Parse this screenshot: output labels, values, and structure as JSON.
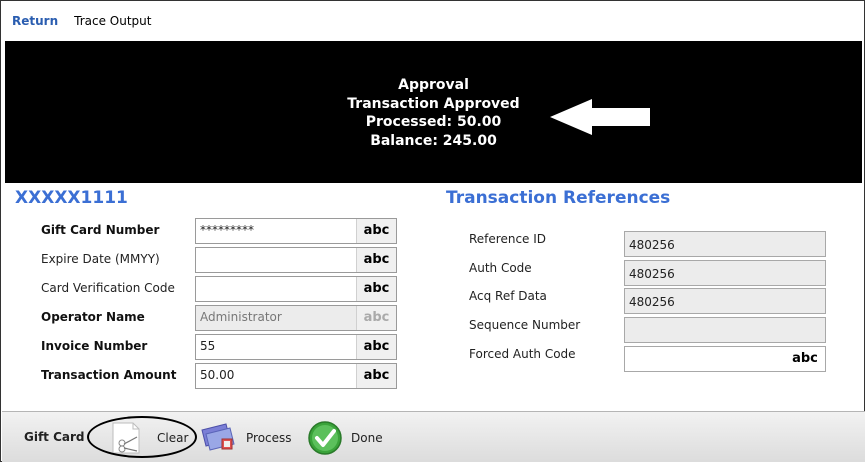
{
  "tabs": [
    {
      "label": "Return",
      "active": true
    },
    {
      "label": "Trace Output",
      "active": false
    }
  ],
  "result": {
    "line1": "Approval",
    "line2": "Transaction Approved",
    "line3": "Processed: 50.00",
    "line4": "Balance: 245.00"
  },
  "card": {
    "masked_number": "XXXXX1111",
    "fields": [
      {
        "label": "Gift Card Number",
        "value": "*********",
        "button": "abc"
      },
      {
        "label": "Expire Date (MMYY)",
        "value": "",
        "button": "abc"
      },
      {
        "label": "Card Verification Code",
        "value": "",
        "button": "abc"
      },
      {
        "label": "Operator Name",
        "value": "Administrator",
        "button": "abc"
      },
      {
        "label": "Invoice Number",
        "value": "55",
        "button": "abc"
      },
      {
        "label": "Transaction Amount",
        "value": "50.00",
        "button": "abc"
      }
    ]
  },
  "references": {
    "title": "Transaction References",
    "fields": [
      {
        "label": "Reference ID",
        "value": "480256"
      },
      {
        "label": "Auth Code",
        "value": "480256"
      },
      {
        "label": "Acq Ref Data",
        "value": "480256"
      },
      {
        "label": "Sequence Number",
        "value": ""
      },
      {
        "label": "Forced Auth Code",
        "value": "",
        "button": "abc"
      }
    ]
  },
  "toolbar": {
    "title": "Gift Card",
    "clear_label": "Clear",
    "process_label": "Process",
    "done_label": "Done"
  },
  "colors": {
    "accent": "#3b6fd4",
    "tab_active": "#2a5db0",
    "result_bg": "#000000",
    "done_green": "#3aa33a"
  }
}
